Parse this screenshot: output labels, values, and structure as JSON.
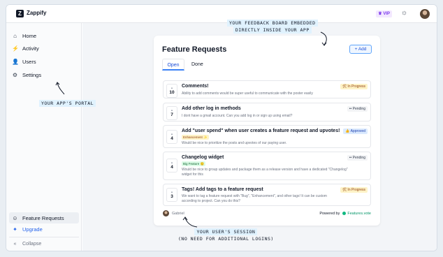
{
  "app": {
    "name": "Zappify",
    "logo_letter": "Z",
    "vip_label": "VIP"
  },
  "sidebar": {
    "items": [
      {
        "label": "Home",
        "icon": "home-icon"
      },
      {
        "label": "Activity",
        "icon": "activity-icon"
      },
      {
        "label": "Users",
        "icon": "users-icon"
      },
      {
        "label": "Settings",
        "icon": "gear-icon"
      }
    ],
    "feature_requests": "Feature Requests",
    "upgrade": "Upgrade",
    "collapse": "Collapse"
  },
  "board": {
    "title": "Feature Requests",
    "add_label": "+ Add",
    "tabs": [
      "Open",
      "Done"
    ],
    "requests": [
      {
        "votes": "10",
        "title": "Comments!",
        "tag": "",
        "desc": "Ability to add comments would be super useful to communicate with the poster easily",
        "status": "🛠 In Progress",
        "status_type": "progress"
      },
      {
        "votes": "7",
        "title": "Add other log in methods",
        "tag": "",
        "desc": "I dont have a gmail account. Can you add log in or sign up using email?",
        "status": "•• Pending",
        "status_type": "pending"
      },
      {
        "votes": "4",
        "title": "Add \"user spend\" when user creates a feature request and upvotes!",
        "tag": "Enhancement ✨",
        "desc": "Would be nice to prioritize the posts and upvotes of our paying user.",
        "status": "👍 Approved",
        "status_type": "approved"
      },
      {
        "votes": "4",
        "title": "Changelog widget",
        "tag": "Big Feature 🙂",
        "desc": "Would be nice to group updates and package them as a release version and have a dedicated \"Changelog\" widget for this",
        "status": "•• Pending",
        "status_type": "pending"
      },
      {
        "votes": "3",
        "title": "Tags! Add tags to a feature request",
        "tag": "",
        "desc": "We want to tag a feature request with \"Bug\", \"Enhancement\", and other tags! It can be custom according to project. Can you do this?",
        "status": "🛠 In Progress",
        "status_type": "progress"
      }
    ],
    "user_name": "Gabriel",
    "powered_by": "Powered by",
    "brand": "Features.vote"
  },
  "annotations": {
    "board_embed_line1": "YOUR FEEDBACK BOARD EMBEDDED",
    "board_embed_line2": "DIRECTLY INSIDE YOUR APP",
    "portal": "YOUR APP'S PORTAL",
    "session_line1": "YOUR USER'S SESSION",
    "session_line2": "(NO NEED FOR ADDITIONAL LOGINS)"
  },
  "colors": {
    "accent": "#3b82f6",
    "upgrade": "#2563eb",
    "brand": "#10b981"
  }
}
